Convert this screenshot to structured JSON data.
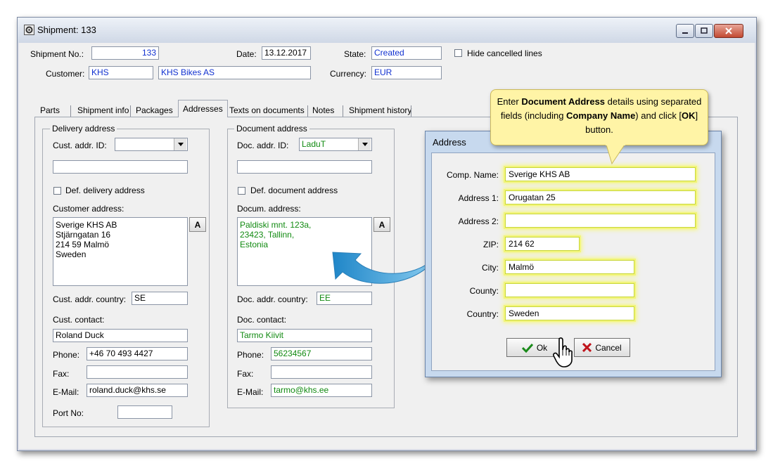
{
  "window": {
    "title": "Shipment: 133"
  },
  "header": {
    "shipment_no_label": "Shipment No.:",
    "shipment_no": "133",
    "date_label": "Date:",
    "date": "13.12.2017",
    "state_label": "State:",
    "state": "Created",
    "hide_cancelled_label": "Hide cancelled lines",
    "customer_label": "Customer:",
    "customer_code": "KHS",
    "customer_name": "KHS Bikes AS",
    "currency_label": "Currency:",
    "currency": "EUR"
  },
  "tabs": [
    "Parts",
    "Shipment info",
    "Packages",
    "Addresses",
    "Texts on documents",
    "Notes",
    "Shipment history"
  ],
  "active_tab": "Addresses",
  "delivery": {
    "group_title": "Delivery address",
    "cust_addr_id_label": "Cust. addr. ID:",
    "cust_addr_id": "",
    "def_delivery_label": "Def. delivery address",
    "customer_address_label": "Customer address:",
    "address_lines": [
      "Sverige KHS AB",
      "Stjärngatan 16",
      "214 59 Malmö",
      "Sweden"
    ],
    "a_button": "A",
    "country_label": "Cust. addr. country:",
    "country": "SE",
    "contact_label": "Cust. contact:",
    "contact": "Roland Duck",
    "phone_label": "Phone:",
    "phone": "+46 70 493 4427",
    "fax_label": "Fax:",
    "fax": "",
    "email_label": "E-Mail:",
    "email": "roland.duck@khs.se",
    "port_label": "Port No:",
    "port": ""
  },
  "document": {
    "group_title": "Document address",
    "doc_addr_id_label": "Doc. addr. ID:",
    "doc_addr_id": "LaduT",
    "def_document_label": "Def. document address",
    "docum_address_label": "Docum. address:",
    "address_lines": [
      "Paldiski mnt. 123a,",
      "23423, Tallinn,",
      "Estonia"
    ],
    "a_button": "A",
    "country_label": "Doc. addr. country:",
    "country": "EE",
    "contact_label": "Doc. contact:",
    "contact": "Tarmo Kiivit",
    "phone_label": "Phone:",
    "phone": "56234567",
    "fax_label": "Fax:",
    "fax": "",
    "email_label": "E-Mail:",
    "email": "tarmo@khs.ee"
  },
  "dialog": {
    "title": "Address",
    "comp_name_label": "Comp. Name:",
    "comp_name": "Sverige KHS AB",
    "address1_label": "Address 1:",
    "address1": "Orugatan 25",
    "address2_label": "Address 2:",
    "address2": "",
    "zip_label": "ZIP:",
    "zip": "214 62",
    "city_label": "City:",
    "city": "Malmö",
    "county_label": "County:",
    "county": "",
    "country_label": "Country:",
    "country": "Sweden",
    "ok_label": "Ok",
    "cancel_label": "Cancel"
  },
  "callout": {
    "t1": "Enter ",
    "b1": "Document Address",
    "t2": " details using separated fields (including ",
    "b2": "Company Name",
    "t3": ") and click [",
    "b3": "OK",
    "t4": "] button."
  },
  "colors": {
    "highlight": "#f2f57a",
    "field_blue": "#1030d0",
    "field_green": "#118a11",
    "arrow": "#3aa3dc"
  }
}
